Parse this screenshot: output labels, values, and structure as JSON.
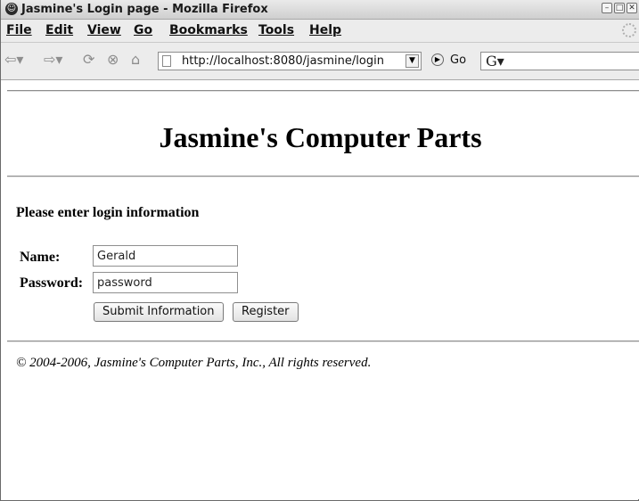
{
  "window": {
    "title": "Jasmine's Login page - Mozilla Firefox",
    "title_icon": "firefox-icon"
  },
  "menubar": {
    "items": [
      "File",
      "Edit",
      "View",
      "Go",
      "Bookmarks",
      "Tools",
      "Help"
    ]
  },
  "navbar": {
    "url": "http://localhost:8080/jasmine/login",
    "go_label": "Go",
    "icons": [
      "back-icon",
      "forward-icon",
      "reload-icon",
      "stop-icon",
      "home-icon"
    ]
  },
  "page": {
    "heading": "Jasmine's Computer Parts",
    "prompt": "Please enter login information",
    "name_label": "Name:",
    "name_value": "Gerald",
    "password_label": "Password:",
    "password_value": "password",
    "submit_label": "Submit Information",
    "register_label": "Register",
    "footer": "© 2004-2006, Jasmine's Computer Parts, Inc., All rights reserved."
  }
}
